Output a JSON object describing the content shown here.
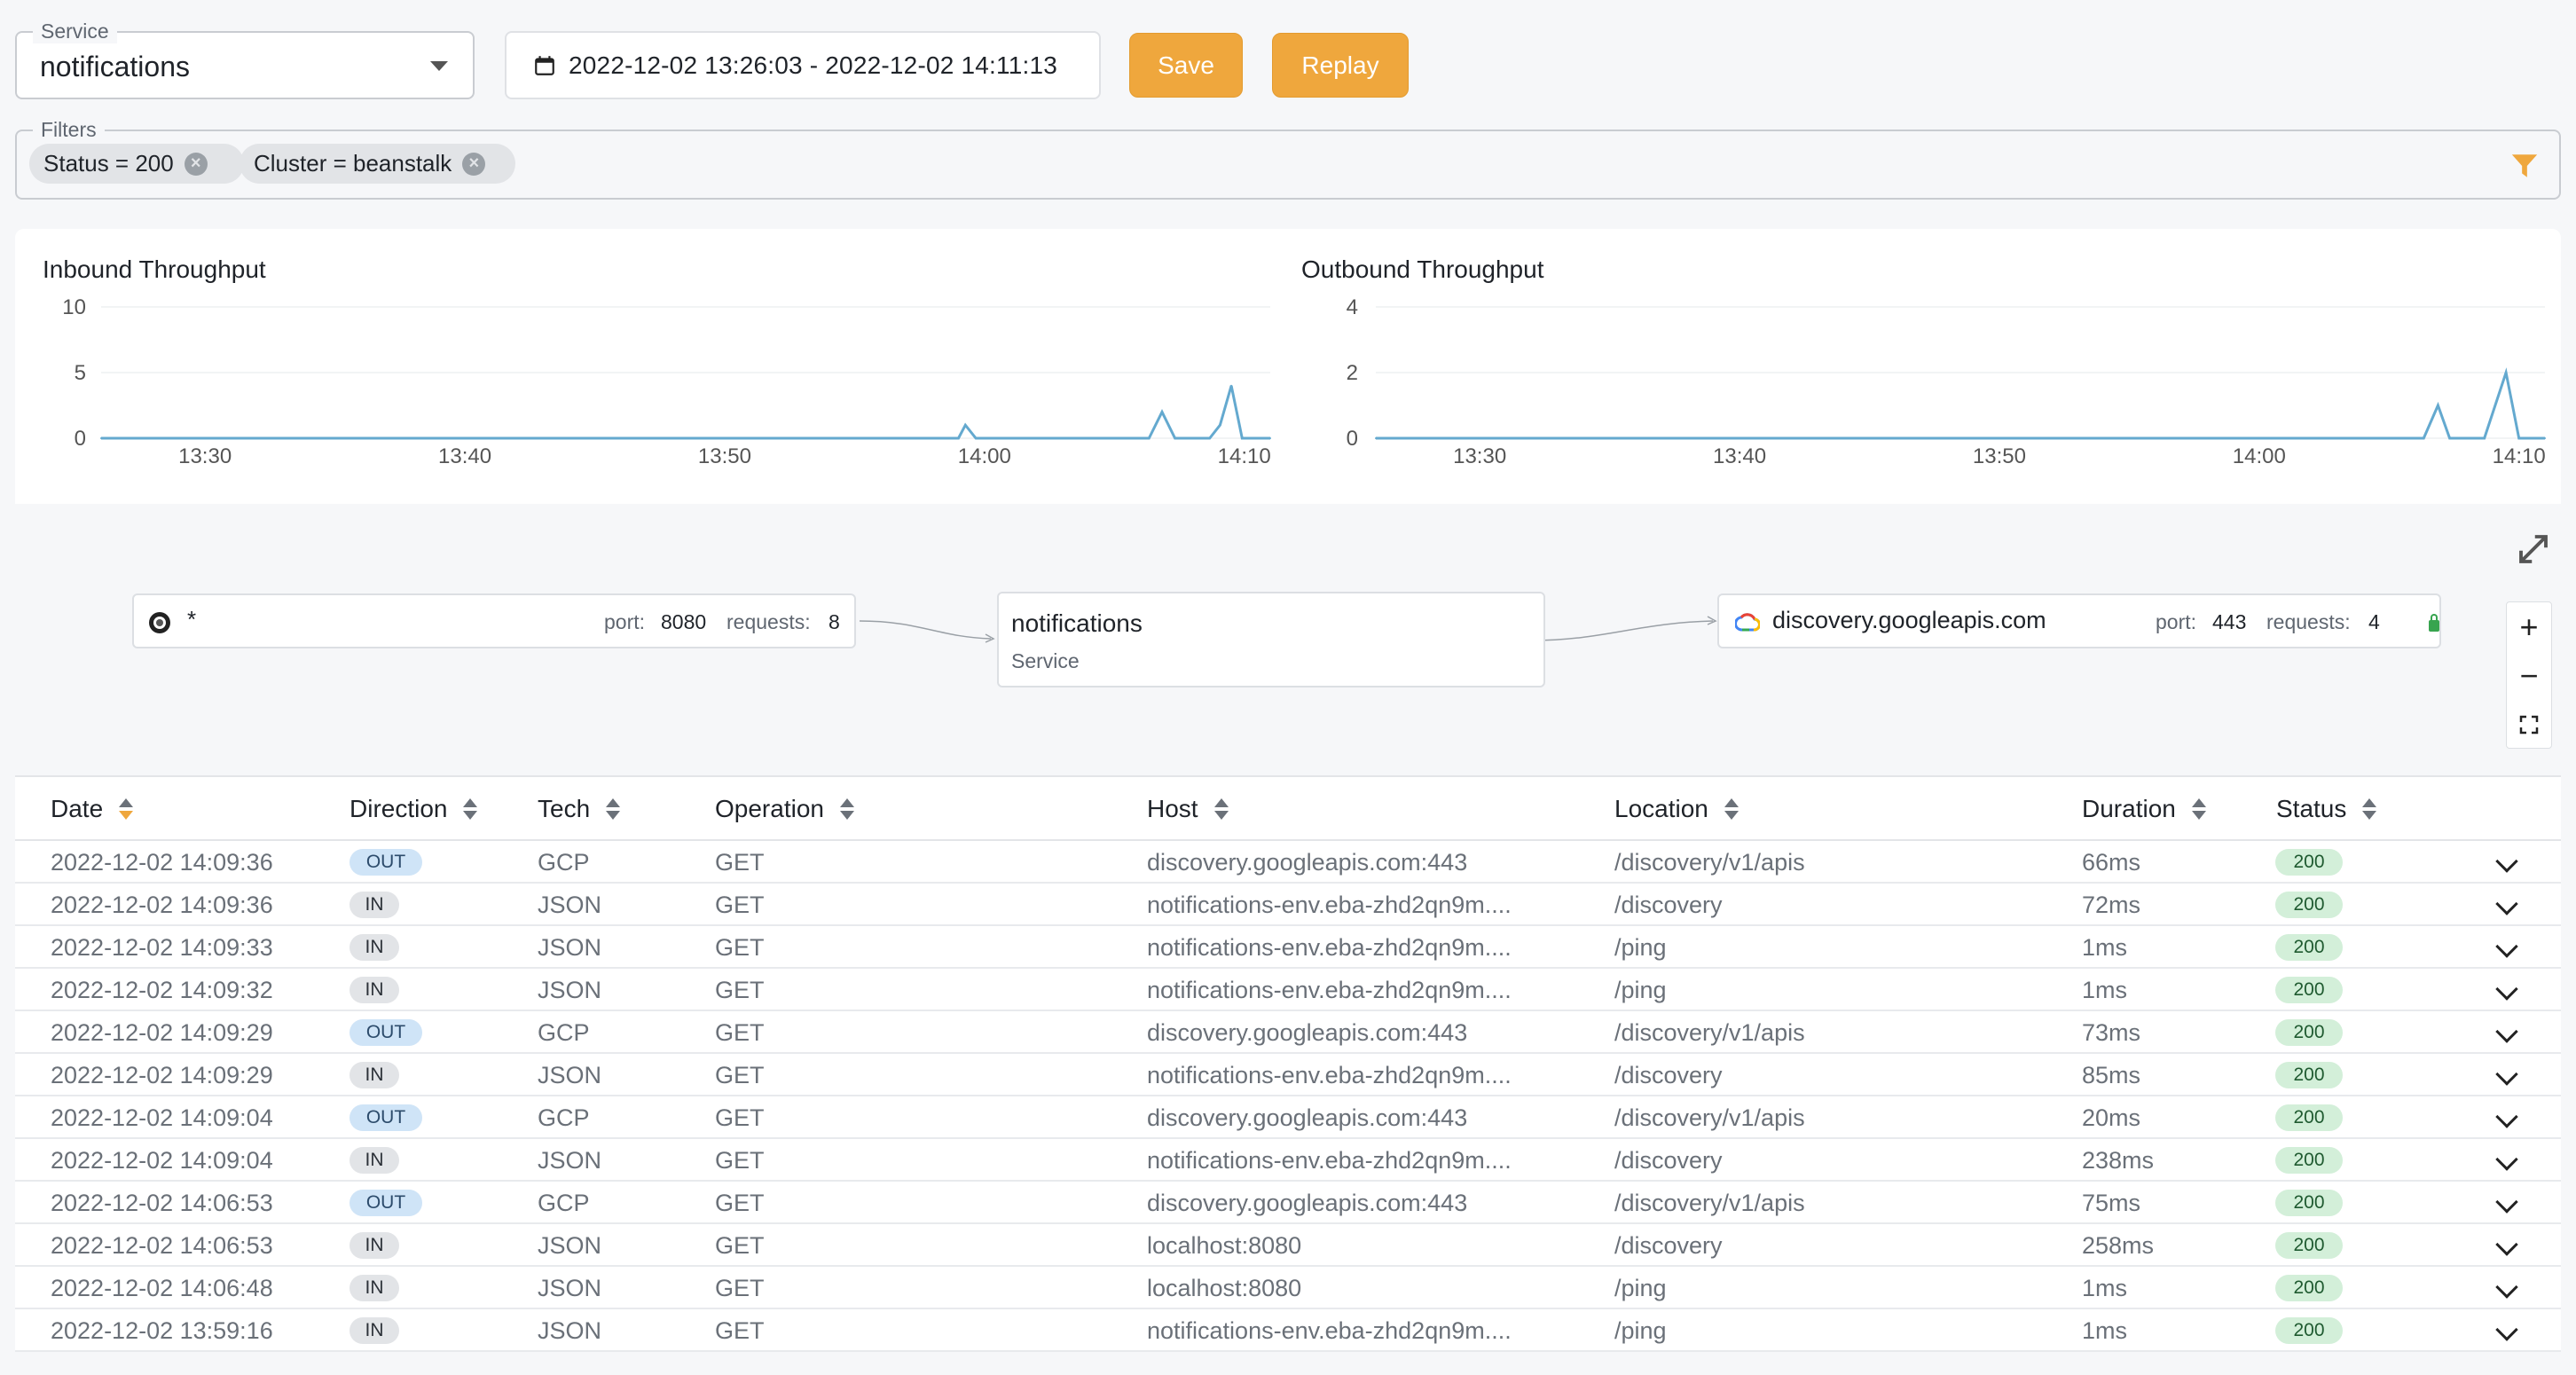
{
  "service": {
    "legend": "Service",
    "value": "notifications"
  },
  "date_range": {
    "value": "2022-12-02 13:26:03 - 2022-12-02 14:11:13"
  },
  "buttons": {
    "save": "Save",
    "replay": "Replay"
  },
  "filters": {
    "legend": "Filters",
    "chips": [
      "Status = 200",
      "Cluster = beanstalk"
    ]
  },
  "colors": {
    "accent": "#efa73d",
    "line": "#64a9cf",
    "out_badge": "#cfe4f7",
    "status_badge": "#d3efd9"
  },
  "chart_data": [
    {
      "type": "line",
      "title": "Inbound Throughput",
      "x_ticks": [
        "13:30",
        "13:40",
        "13:50",
        "14:00",
        "14:10"
      ],
      "y_ticks": [
        "10",
        "5",
        "0"
      ],
      "ylim": [
        0,
        10
      ],
      "x_minutes_range": [
        "13:26",
        "14:11"
      ],
      "points": [
        [
          "13:26",
          0
        ],
        [
          "13:59",
          0
        ],
        [
          "13:59:16",
          1
        ],
        [
          "13:59:40",
          0
        ],
        [
          "14:06:20",
          0
        ],
        [
          "14:06:50",
          2
        ],
        [
          "14:07:20",
          0
        ],
        [
          "14:08:40",
          0
        ],
        [
          "14:09:04",
          1
        ],
        [
          "14:09:30",
          4
        ],
        [
          "14:09:55",
          0
        ],
        [
          "14:11",
          0
        ]
      ],
      "grid": true
    },
    {
      "type": "line",
      "title": "Outbound Throughput",
      "x_ticks": [
        "13:30",
        "13:40",
        "13:50",
        "14:00",
        "14:10"
      ],
      "y_ticks": [
        "4",
        "2",
        "0"
      ],
      "ylim": [
        0,
        4
      ],
      "x_minutes_range": [
        "13:26",
        "14:11"
      ],
      "points": [
        [
          "13:26",
          0
        ],
        [
          "14:06:20",
          0
        ],
        [
          "14:06:53",
          1
        ],
        [
          "14:07:20",
          0
        ],
        [
          "14:08:40",
          0
        ],
        [
          "14:09:30",
          2
        ],
        [
          "14:10:00",
          0
        ],
        [
          "14:11",
          0
        ]
      ],
      "grid": true
    }
  ],
  "graph": {
    "source": {
      "label": "*",
      "port_label": "port:",
      "port": "8080",
      "req_label": "requests:",
      "requests": "8"
    },
    "service": {
      "label": "notifications",
      "sub": "Service"
    },
    "dest": {
      "label": "discovery.googleapis.com",
      "port_label": "port:",
      "port": "443",
      "req_label": "requests:",
      "requests": "4"
    }
  },
  "table": {
    "headers": [
      "Date",
      "Direction",
      "Tech",
      "Operation",
      "Host",
      "Location",
      "Duration",
      "Status"
    ],
    "rows": [
      [
        "2022-12-02 14:09:36",
        "OUT",
        "GCP",
        "GET",
        "discovery.googleapis.com:443",
        "/discovery/v1/apis",
        "66ms",
        "200"
      ],
      [
        "2022-12-02 14:09:36",
        "IN",
        "JSON",
        "GET",
        "notifications-env.eba-zhd2qn9m....",
        "/discovery",
        "72ms",
        "200"
      ],
      [
        "2022-12-02 14:09:33",
        "IN",
        "JSON",
        "GET",
        "notifications-env.eba-zhd2qn9m....",
        "/ping",
        "1ms",
        "200"
      ],
      [
        "2022-12-02 14:09:32",
        "IN",
        "JSON",
        "GET",
        "notifications-env.eba-zhd2qn9m....",
        "/ping",
        "1ms",
        "200"
      ],
      [
        "2022-12-02 14:09:29",
        "OUT",
        "GCP",
        "GET",
        "discovery.googleapis.com:443",
        "/discovery/v1/apis",
        "73ms",
        "200"
      ],
      [
        "2022-12-02 14:09:29",
        "IN",
        "JSON",
        "GET",
        "notifications-env.eba-zhd2qn9m....",
        "/discovery",
        "85ms",
        "200"
      ],
      [
        "2022-12-02 14:09:04",
        "OUT",
        "GCP",
        "GET",
        "discovery.googleapis.com:443",
        "/discovery/v1/apis",
        "20ms",
        "200"
      ],
      [
        "2022-12-02 14:09:04",
        "IN",
        "JSON",
        "GET",
        "notifications-env.eba-zhd2qn9m....",
        "/discovery",
        "238ms",
        "200"
      ],
      [
        "2022-12-02 14:06:53",
        "OUT",
        "GCP",
        "GET",
        "discovery.googleapis.com:443",
        "/discovery/v1/apis",
        "75ms",
        "200"
      ],
      [
        "2022-12-02 14:06:53",
        "IN",
        "JSON",
        "GET",
        "localhost:8080",
        "/discovery",
        "258ms",
        "200"
      ],
      [
        "2022-12-02 14:06:48",
        "IN",
        "JSON",
        "GET",
        "localhost:8080",
        "/ping",
        "1ms",
        "200"
      ],
      [
        "2022-12-02 13:59:16",
        "IN",
        "JSON",
        "GET",
        "notifications-env.eba-zhd2qn9m....",
        "/ping",
        "1ms",
        "200"
      ]
    ]
  }
}
